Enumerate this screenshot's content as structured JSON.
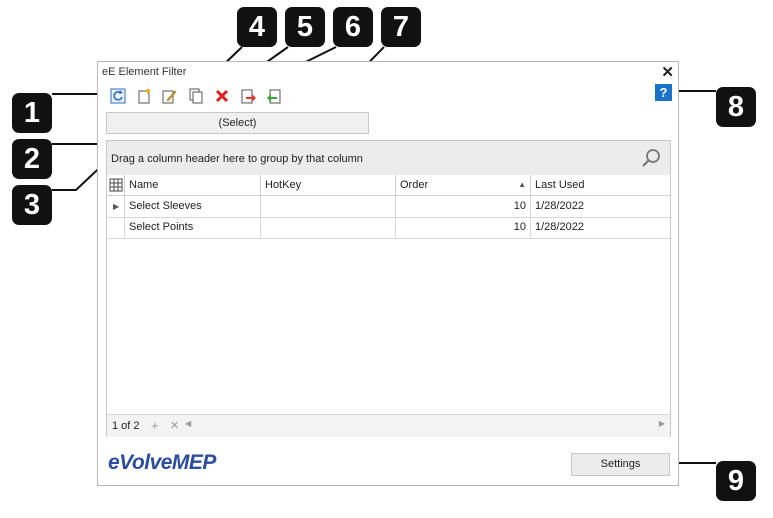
{
  "window": {
    "title": "eE Element Filter",
    "close": "✕",
    "help": "?"
  },
  "toolbar": {
    "icons": [
      "refresh-icon",
      "new-icon",
      "edit-icon",
      "copy-icon",
      "delete-icon",
      "export-icon",
      "import-icon"
    ]
  },
  "tab": {
    "label": "(Select)"
  },
  "grid": {
    "group_panel_text": "Drag a column header here to group by that column",
    "columns": [
      "Name",
      "HotKey",
      "Order",
      "Last Used"
    ],
    "rows": [
      {
        "name": "Select Sleeves",
        "hotkey": "",
        "order": "10",
        "last_used": "1/28/2022"
      },
      {
        "name": "Select Points",
        "hotkey": "",
        "order": "10",
        "last_used": "1/28/2022"
      }
    ],
    "pager": {
      "text": "1 of 2",
      "add": "+",
      "remove": "✕"
    }
  },
  "footer": {
    "logo": "eVolveMEP",
    "settings_label": "Settings"
  },
  "callouts": [
    "1",
    "2",
    "3",
    "4",
    "5",
    "6",
    "7",
    "8",
    "9"
  ],
  "colors": {
    "accent": "#1a73c9",
    "logo": "#2c4c9c",
    "callout": "#111111"
  }
}
